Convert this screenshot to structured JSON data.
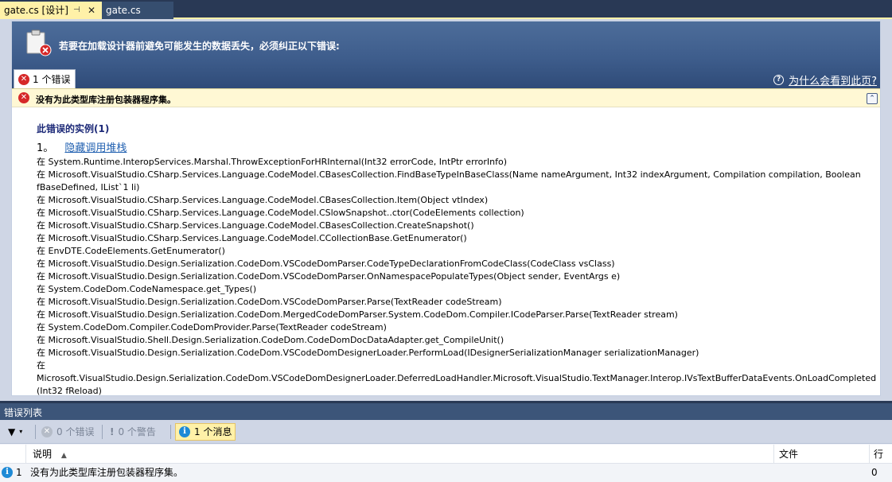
{
  "tabs": [
    {
      "label": "gate.cs [设计]",
      "active": true
    },
    {
      "label": "gate.cs",
      "active": false
    }
  ],
  "designer": {
    "header_title": "若要在加载设计器前避免可能发生的数据丢失，必须纠正以下错误:",
    "error_tab_label": "1 个错误",
    "why_link": "为什么会看到此页?",
    "error_message": "没有为此类型库注册包装器程序集。",
    "instances_heading": "此错误的实例(1)",
    "instance_number": "1。",
    "hide_stack_link": "隐藏调用堆栈",
    "stack_trace": [
      "在 System.Runtime.InteropServices.Marshal.ThrowExceptionForHRInternal(Int32 errorCode, IntPtr errorInfo)",
      "在 Microsoft.VisualStudio.CSharp.Services.Language.CodeModel.CBasesCollection.FindBaseTypeInBaseClass(Name nameArgument, Int32 indexArgument, Compilation compilation, Boolean",
      "fBaseDefined, IList`1 li)",
      "在 Microsoft.VisualStudio.CSharp.Services.Language.CodeModel.CBasesCollection.Item(Object vtIndex)",
      "在 Microsoft.VisualStudio.CSharp.Services.Language.CodeModel.CSlowSnapshot..ctor(CodeElements collection)",
      "在 Microsoft.VisualStudio.CSharp.Services.Language.CodeModel.CBasesCollection.CreateSnapshot()",
      "在 Microsoft.VisualStudio.CSharp.Services.Language.CodeModel.CCollectionBase.GetEnumerator()",
      "在 EnvDTE.CodeElements.GetEnumerator()",
      "在 Microsoft.VisualStudio.Design.Serialization.CodeDom.VSCodeDomParser.CodeTypeDeclarationFromCodeClass(CodeClass vsClass)",
      "在 Microsoft.VisualStudio.Design.Serialization.CodeDom.VSCodeDomParser.OnNamespacePopulateTypes(Object sender, EventArgs e)",
      "在 System.CodeDom.CodeNamespace.get_Types()",
      "在 Microsoft.VisualStudio.Design.Serialization.CodeDom.VSCodeDomParser.Parse(TextReader codeStream)",
      "在 Microsoft.VisualStudio.Design.Serialization.CodeDom.MergedCodeDomParser.System.CodeDom.Compiler.ICodeParser.Parse(TextReader stream)",
      "在 System.CodeDom.Compiler.CodeDomProvider.Parse(TextReader codeStream)",
      "在 Microsoft.VisualStudio.Shell.Design.Serialization.CodeDom.CodeDomDocDataAdapter.get_CompileUnit()",
      "在 Microsoft.VisualStudio.Design.Serialization.CodeDom.VSCodeDomDesignerLoader.PerformLoad(IDesignerSerializationManager serializationManager)",
      "在 Microsoft.VisualStudio.Design.Serialization.CodeDom.VSCodeDomDesignerLoader.DeferredLoadHandler.Microsoft.VisualStudio.TextManager.Interop.IVsTextBufferDataEvents.OnLoadCompleted",
      "(Int32 fReload)"
    ]
  },
  "error_list": {
    "title": "错误列表",
    "errors_filter": "0 个错误",
    "warnings_filter": "0 个警告",
    "messages_filter": "1 个消息",
    "columns": {
      "description": "说明",
      "file": "文件",
      "line": "行"
    },
    "rows": [
      {
        "index": "1",
        "description": "没有为此类型库注册包装器程序集。",
        "file": "",
        "line": "0"
      }
    ]
  },
  "colors": {
    "tab_active_bg": "#fff1a8",
    "ide_bg": "#293955",
    "header_blue": "#3e5d8c",
    "error_red": "#d62828",
    "info_blue": "#1e8ad6"
  }
}
